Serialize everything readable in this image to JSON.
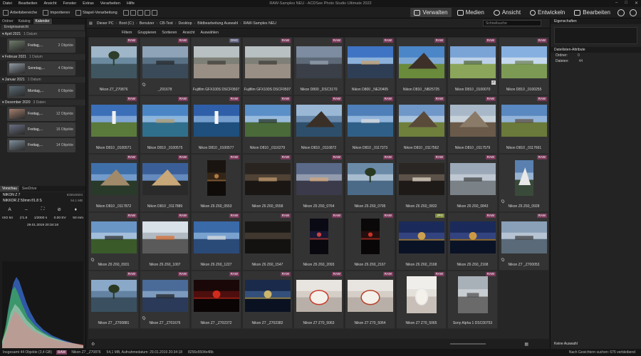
{
  "window": {
    "title": "RAW-Samples NEU - ACDSee Photo Studio Ultimate 2022"
  },
  "menu": [
    "Datei",
    "Bearbeiten",
    "Ansicht",
    "Fenster",
    "Extras",
    "Verarbeiten",
    "Hilfe"
  ],
  "toolbar": {
    "items": [
      "Arbeitsbereiche",
      "Importieren",
      "Stapel-Verarbeitung"
    ],
    "modes": [
      {
        "label": "Verwalten",
        "icon": "manage-icon",
        "active": true
      },
      {
        "label": "Medien",
        "icon": "media-icon",
        "active": false
      },
      {
        "label": "Ansicht",
        "icon": "eye-icon",
        "active": false
      },
      {
        "label": "Entwickeln",
        "icon": "develop-icon",
        "active": false
      },
      {
        "label": "Bearbeiten",
        "icon": "edit-brush-icon",
        "active": false
      }
    ]
  },
  "left_panel": {
    "tabs": [
      "Ordner",
      "Katalog",
      "Kalender"
    ],
    "active_tab": "Kalender",
    "view_select": "Ereignisansicht",
    "months": [
      {
        "label": "April 2021",
        "count": "1 Datum",
        "days": [
          {
            "label": "Freitag,...",
            "count": "2 Objekte"
          }
        ]
      },
      {
        "label": "Februar 2021",
        "count": "1 Datum",
        "days": [
          {
            "label": "Sonntag,...",
            "count": "4 Objekte"
          }
        ]
      },
      {
        "label": "Januar 2021",
        "count": "1 Datum",
        "days": [
          {
            "label": "Montag,...",
            "count": "6 Objekte"
          }
        ]
      },
      {
        "label": "Dezember 2020",
        "count": "3 Daten",
        "days": [
          {
            "label": "Freitag,...",
            "count": "12 Objekte"
          },
          {
            "label": "Freitag,...",
            "count": "16 Objekte"
          },
          {
            "label": "Freitag,...",
            "count": "14 Objekte"
          }
        ]
      }
    ]
  },
  "preview": {
    "tabs": [
      "Vorschau",
      "SeeDrive"
    ],
    "camera": "NIKON Z 7",
    "camera_res": "8256x5504",
    "lens": "NIKKOR Z 50mm f/1.8 S",
    "lens_size": "54.1 MB",
    "mode_icons": [
      "A",
      "--",
      "⛶",
      "⊘",
      "♦"
    ],
    "iso": "ISO 64",
    "aperture": "ƒ/1.8",
    "shutter": "1/2000 s",
    "ev": "0.00 EV",
    "focal": "50 mm",
    "date": "29.01.2019 20:34:18",
    "histogram": {
      "channels": [
        "red",
        "green",
        "blue"
      ],
      "colors": [
        "#d04040",
        "#40c040",
        "#4060e0"
      ]
    }
  },
  "pathbar": {
    "crumbs": [
      "Dieser PC",
      "Boot (C:)",
      "Benutzer",
      "CB-Test",
      "Desktop",
      "Bildbearbeitung Auswahl",
      "RAW-Samples NEU"
    ],
    "search_placeholder": "Schnellsuche"
  },
  "filterbar": [
    "Filtern",
    "Gruppieren",
    "Sortieren",
    "Ansicht",
    "Auswählen"
  ],
  "thumbnails": [
    {
      "caption": "Nikon Z7_Z70876",
      "badge": "RAW",
      "scene": "tree"
    },
    {
      "caption": "_Z01678",
      "badge": "RAW",
      "scene": "pier",
      "pin": true
    },
    {
      "caption": "Fujifilm GFX100S DSCF0507",
      "badge": "DNG",
      "scene": "forest"
    },
    {
      "caption": "Fujifilm GFX100S DSCF0507",
      "badge": "RAW",
      "scene": "forest"
    },
    {
      "caption": "Nikon D800 _DSC3170",
      "badge": "RAW",
      "scene": "sky"
    },
    {
      "caption": "Nikon D800 _NE20405",
      "badge": "RAW",
      "scene": "village"
    },
    {
      "caption": "Nikon D810 _NB25725",
      "badge": "RAW",
      "scene": "rock"
    },
    {
      "caption": "Nikon D810 _0100070",
      "badge": "RAW",
      "scene": "meadow",
      "check": true
    },
    {
      "caption": "Nikon D810 _0100255",
      "badge": "RAW",
      "scene": "meadow2"
    },
    {
      "caption": "Nikon D810 _0100571",
      "badge": "RAW",
      "scene": "lighthouse"
    },
    {
      "caption": "Nikon D810 _0100575",
      "badge": "RAW",
      "scene": "coast"
    },
    {
      "caption": "Nikon D810 _0100577",
      "badge": "RAW",
      "scene": "lighthouse2"
    },
    {
      "caption": "Nikon D810 _0116279",
      "badge": "RAW",
      "scene": "palms"
    },
    {
      "caption": "Nikon D810 _0116872",
      "badge": "RAW",
      "scene": "arch"
    },
    {
      "caption": "Nikon D810 _0117373",
      "badge": "RAW",
      "scene": "harbor"
    },
    {
      "caption": "Nikon D810 _0117562",
      "badge": "RAW",
      "scene": "cliff"
    },
    {
      "caption": "Nikon D810 _0117579",
      "badge": "RAW",
      "scene": "cliff2"
    },
    {
      "caption": "Nikon D810 _0117661",
      "badge": "RAW",
      "scene": "church"
    },
    {
      "caption": "Nikon D810 _0117872",
      "badge": "RAW",
      "scene": "hill"
    },
    {
      "caption": "Nikon D810 _0117889",
      "badge": "RAW",
      "scene": "hill2"
    },
    {
      "caption": "Nikon Z6 Z60_0553",
      "badge": "RAW",
      "scene": "night",
      "shape": "tall"
    },
    {
      "caption": "Nikon Z6 Z60_0558",
      "badge": "RAW",
      "scene": "interior"
    },
    {
      "caption": "Nikon Z6 Z60_0764",
      "badge": "RAW",
      "scene": "cloudy"
    },
    {
      "caption": "Nikon Z6 Z60_0795",
      "badge": "RAW",
      "scene": "lake"
    },
    {
      "caption": "Nikon Z6 Z60_0832",
      "badge": "RAW",
      "scene": "room"
    },
    {
      "caption": "Nikon Z6 Z60_0843",
      "badge": "RAW",
      "scene": "beach"
    },
    {
      "caption": "Nikon Z6 Z60_0928",
      "badge": "RAW",
      "scene": "mountain",
      "shape": "tall",
      "pin": true
    },
    {
      "caption": "Nikon Z6 Z60_0931",
      "badge": "RAW",
      "scene": "valley",
      "pin": true
    },
    {
      "caption": "Nikon Z6 Z60_1007",
      "badge": "RAW",
      "scene": "bike"
    },
    {
      "caption": "Nikon Z6 Z60_1227",
      "badge": "RAW",
      "scene": "boats"
    },
    {
      "caption": "Nikon Z6 Z60_1547",
      "badge": "RAW",
      "scene": "dark"
    },
    {
      "caption": "Nikon Z6 Z60_2093",
      "badge": "RAW",
      "scene": "nightlight",
      "shape": "tall"
    },
    {
      "caption": "Nikon Z6 Z60_2167",
      "badge": "RAW",
      "scene": "redlight",
      "shape": "tall"
    },
    {
      "caption": "Nikon Z6 Z60_2168",
      "badge": "JPG",
      "scene": "nightharbor"
    },
    {
      "caption": "Nikon Z6 Z60_2168",
      "badge": "RAW",
      "scene": "nightharbor2"
    },
    {
      "caption": "Nikon Z7 _Z700053",
      "badge": "RAW",
      "scene": "seascape",
      "pin": true
    },
    {
      "caption": "Nikon Z7 _Z700881",
      "badge": "RAW",
      "scene": "tree2"
    },
    {
      "caption": "Nikon Z7 _Z701676",
      "badge": "RAW",
      "scene": "pier2",
      "pin": true
    },
    {
      "caption": "Nikon Z7 _Z702372",
      "badge": "RAW",
      "scene": "bridge"
    },
    {
      "caption": "Nikon Z7 _Z702382",
      "badge": "RAW",
      "scene": "city"
    },
    {
      "caption": "Nikon Z7 Z70_5063",
      "badge": "RAW",
      "scene": "horse"
    },
    {
      "caption": "Nikon Z7 Z70_5064",
      "badge": "RAW",
      "scene": "horse2"
    },
    {
      "caption": "Nikon Z7 Z70_5065",
      "badge": "RAW",
      "scene": "bear",
      "shape": "tallw"
    },
    {
      "caption": "Sony Alpha 1 DSC00753",
      "badge": "RAW",
      "scene": "street",
      "shape": "tallw"
    }
  ],
  "right_panel": {
    "title": "Eigenschaften",
    "section": "Dateilisten-Attribute",
    "rows": [
      {
        "label": "Ordner:",
        "value": "0"
      },
      {
        "label": "Dateien:",
        "value": "44"
      }
    ],
    "empty_label": "Keine Auswahl"
  },
  "status": {
    "total": "Insgesamt 44 Objekte (3,4 GB)",
    "badge": "RAW",
    "file": "Nikon Z7 _Z70876",
    "info": "54,1 MB, Aufnahmedatum: 29.01.2019 20:34:18",
    "dims": "8256x5504x48b",
    "right": "Nach Gesichtern suchen: 675 verbleibend"
  }
}
